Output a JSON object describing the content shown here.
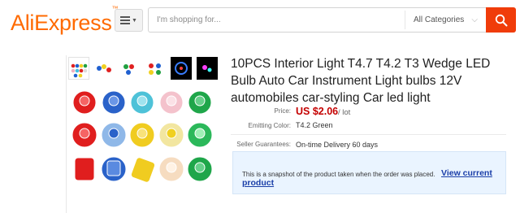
{
  "header": {
    "logo_text": "AliExpress",
    "logo_tm": "™",
    "search_placeholder": "I'm shopping for...",
    "category_label": "All Categories",
    "brand_color": "#ff6a00",
    "search_button_color": "#f03c0a",
    "icons": [
      "menu-icon",
      "chevron-down-icon",
      "search-icon"
    ]
  },
  "gallery": {
    "thumbnail_count": 6,
    "selected_thumbnail": 1,
    "main_image_desc_colors": [
      "red",
      "blue",
      "cyan",
      "pink",
      "green",
      "yellow",
      "white"
    ]
  },
  "product": {
    "title": "10PCS Interior Light T4.7 T4.2 T3 Wedge LED Bulb Auto Car Instrument Light bulbs 12V automobiles car-styling Car led light",
    "price_label": "Price:",
    "price": "US $2.06",
    "price_unit": "/ lot",
    "emitting_label": "Emitting Color:",
    "emitting_value": "T4.2 Green",
    "guarantee_label": "Seller Guarantees:",
    "guarantee_value": "On-time Delivery 60 days"
  },
  "snapshot": {
    "text": "This is a snapshot of the product taken when the order was placed.",
    "link": "View current product"
  }
}
